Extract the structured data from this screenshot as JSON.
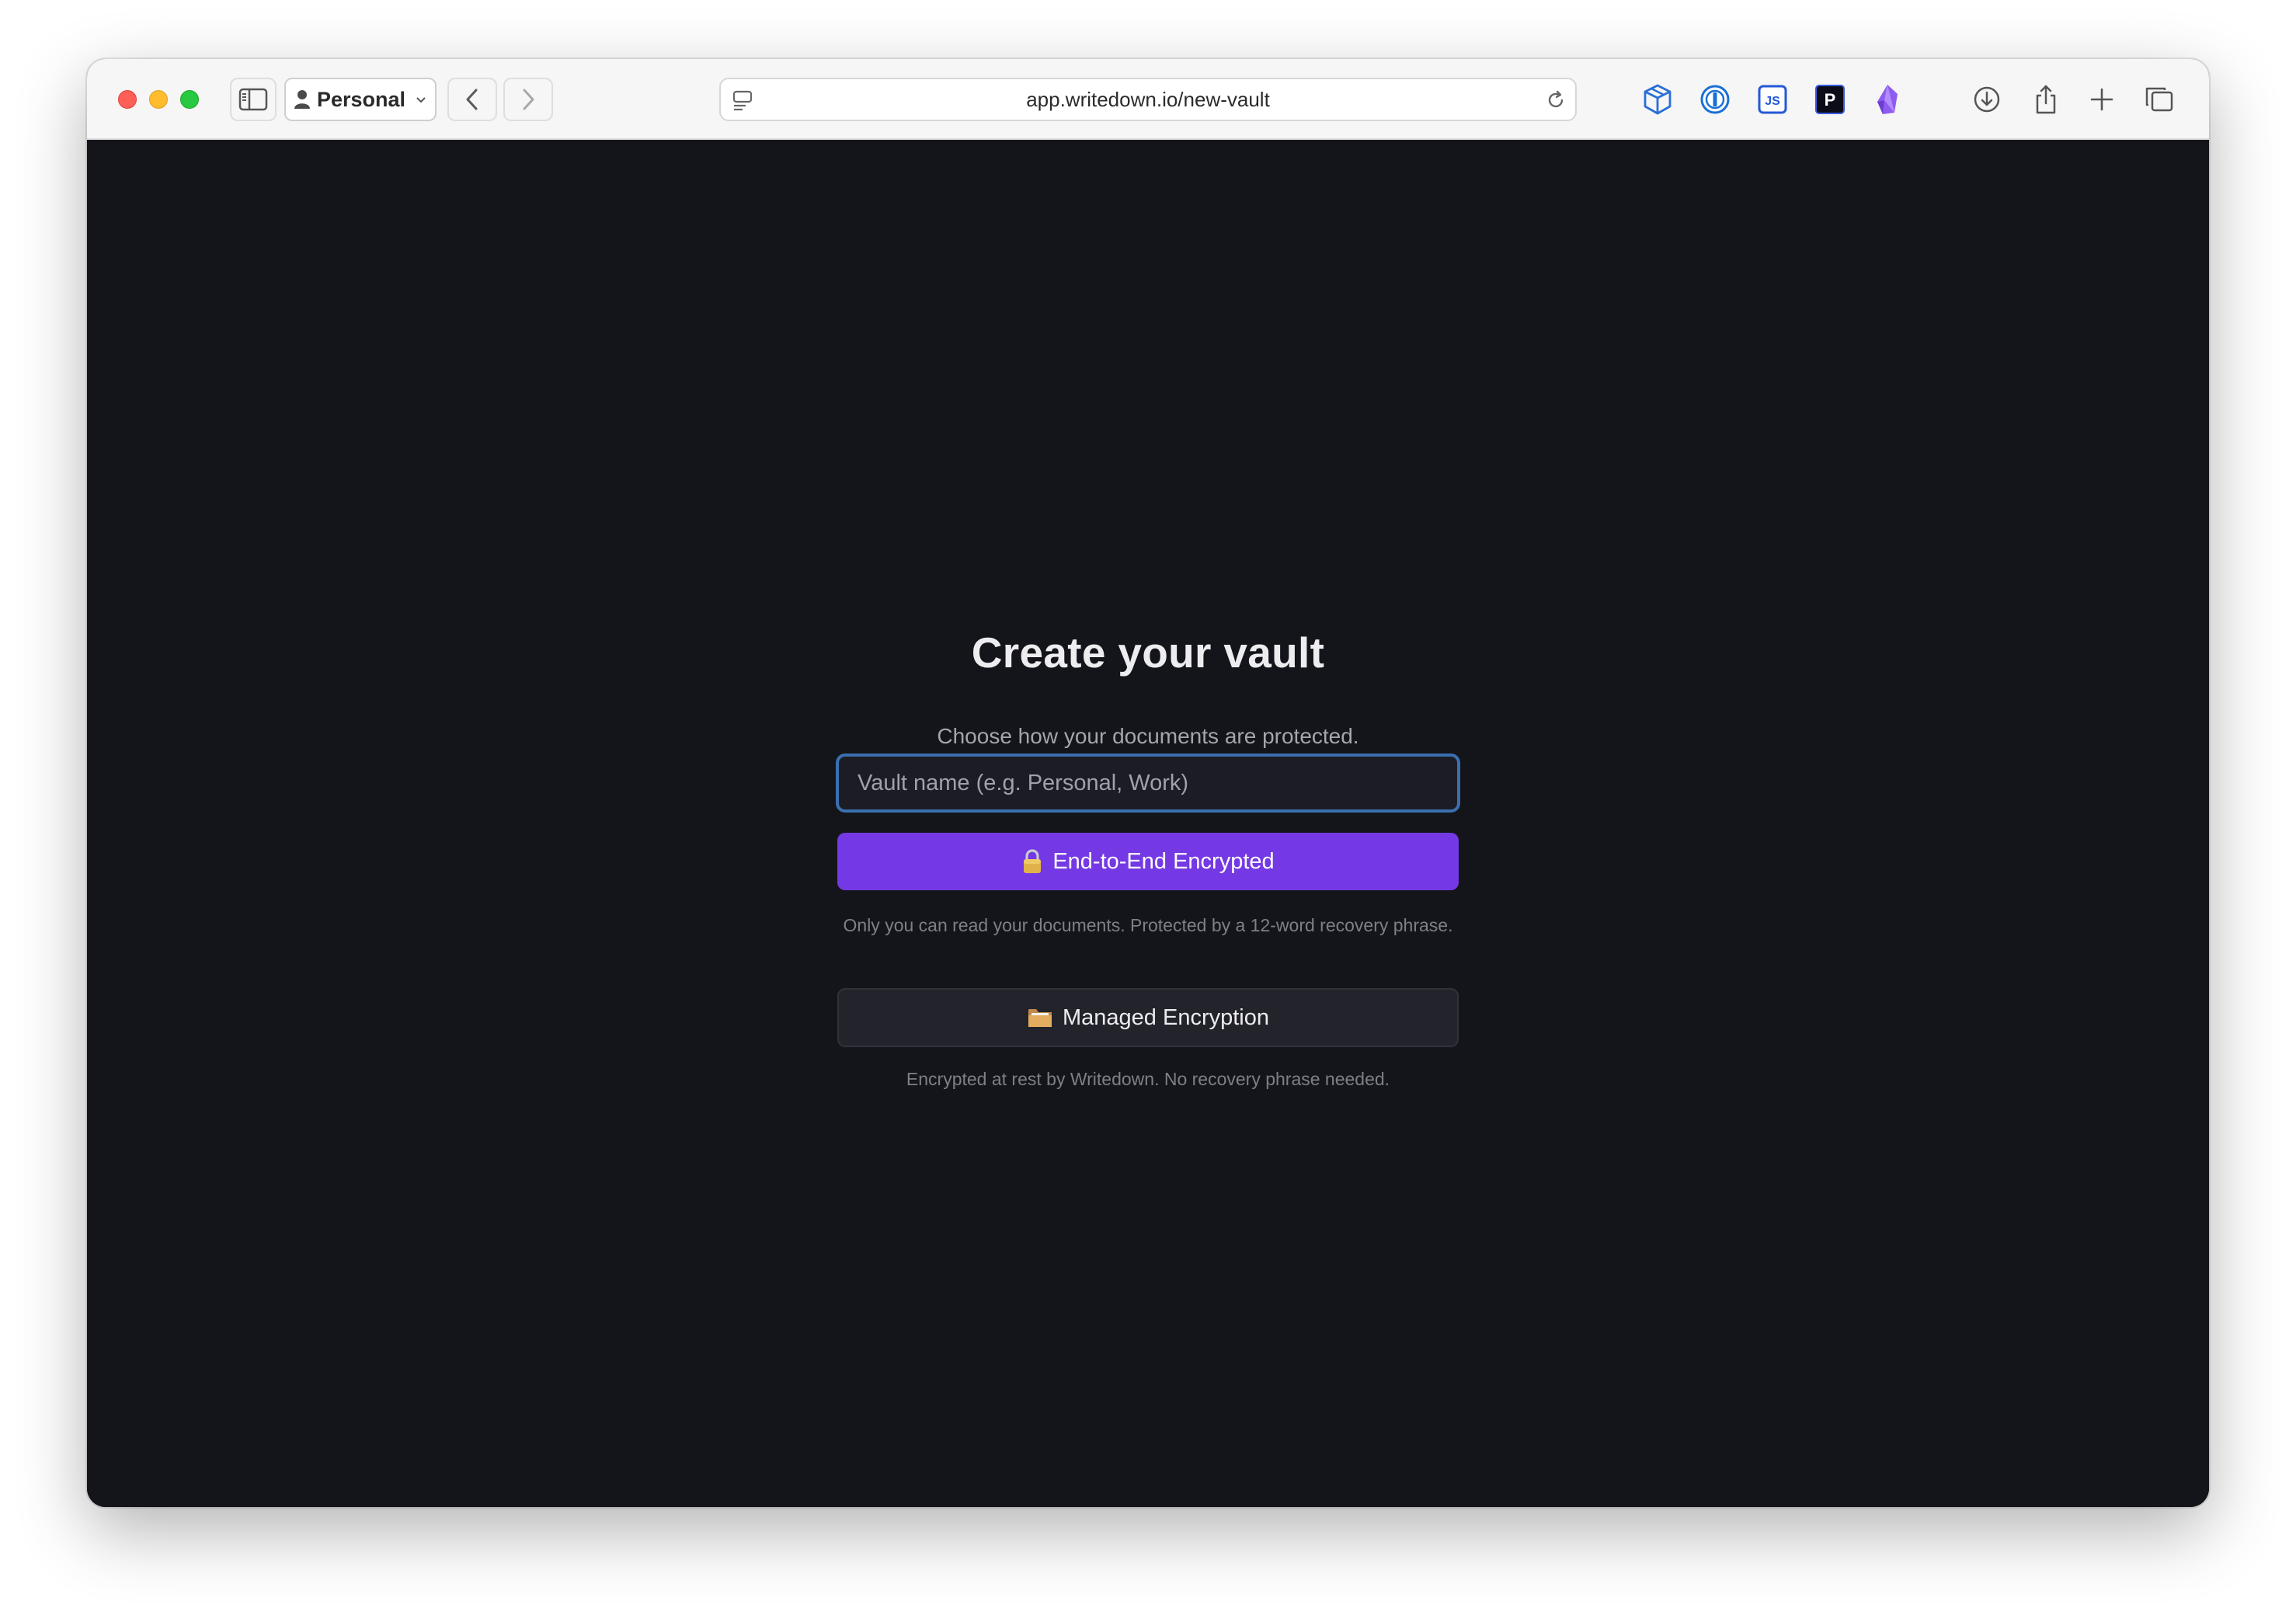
{
  "browser": {
    "profile_label": "Personal",
    "url": "app.writedown.io/new-vault"
  },
  "page": {
    "title": "Create your vault",
    "subtitle": "Choose how your documents are protected.",
    "vault_input": {
      "placeholder": "Vault name (e.g. Personal, Work)",
      "value": ""
    },
    "e2e_option": {
      "icon": "lock-icon",
      "label": "End-to-End Encrypted",
      "description": "Only you can read your documents. Protected by a 12-word recovery phrase."
    },
    "managed_option": {
      "icon": "folder-icon",
      "label": "Managed Encryption",
      "description": "Encrypted at rest by Writedown. No recovery phrase needed."
    }
  },
  "colors": {
    "page_background": "#14151b",
    "primary_button": "#7439e4",
    "secondary_button": "#22232b",
    "input_focus_border": "#3b6fb0"
  },
  "extensions": [
    "cube-extension-icon",
    "password-manager-icon",
    "js-extension-icon",
    "p-extension-icon",
    "obsidian-icon"
  ],
  "extension_labels": {
    "js": "JS",
    "p": "P"
  }
}
